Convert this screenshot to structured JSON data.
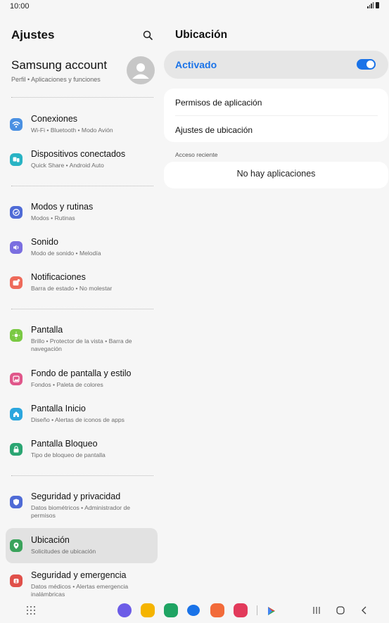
{
  "status_bar": {
    "time": "10:00"
  },
  "left_pane": {
    "title": "Ajustes",
    "account": {
      "title": "Samsung account",
      "subtitle": "Perfil  •  Aplicaciones y funciones"
    },
    "items": [
      {
        "label": "Conexiones",
        "subtitle": "Wi-Fi  •  Bluetooth  •  Modo Avión",
        "icon": "wifi-icon",
        "color": "#4a90e2"
      },
      {
        "label": "Dispositivos conectados",
        "subtitle": "Quick Share  •  Android Auto",
        "icon": "connected-devices-icon",
        "color": "#28b3c4"
      },
      {
        "label": "Modos y rutinas",
        "subtitle": "Modos  •  Rutinas",
        "icon": "modes-icon",
        "color": "#4f6bd6"
      },
      {
        "label": "Sonido",
        "subtitle": "Modo de sonido  •  Melodía",
        "icon": "sound-icon",
        "color": "#7a6ee0"
      },
      {
        "label": "Notificaciones",
        "subtitle": "Barra de estado  •  No molestar",
        "icon": "notifications-icon",
        "color": "#ee6a5a"
      },
      {
        "label": "Pantalla",
        "subtitle": "Brillo  •  Protector de la vista  •  Barra de navegación",
        "icon": "display-icon",
        "color": "#7ac943"
      },
      {
        "label": "Fondo de pantalla y estilo",
        "subtitle": "Fondos  •  Paleta de colores",
        "icon": "wallpaper-icon",
        "color": "#e0568a"
      },
      {
        "label": "Pantalla Inicio",
        "subtitle": "Diseño  •  Alertas de iconos de apps",
        "icon": "home-icon",
        "color": "#2ba6de"
      },
      {
        "label": "Pantalla Bloqueo",
        "subtitle": "Tipo de bloqueo de pantalla",
        "icon": "lock-icon",
        "color": "#2aa572"
      },
      {
        "label": "Seguridad y privacidad",
        "subtitle": "Datos biométricos  •  Administrador de permisos",
        "icon": "shield-icon",
        "color": "#4f6bd6"
      },
      {
        "label": "Ubicación",
        "subtitle": "Solicitudes de ubicación",
        "icon": "location-icon",
        "color": "#3aa35b"
      },
      {
        "label": "Seguridad y emergencia",
        "subtitle": "Datos médicos  •  Alertas emergencia inalámbricas",
        "icon": "emergency-icon",
        "color": "#e0504a"
      }
    ]
  },
  "right_pane": {
    "title": "Ubicación",
    "toggle": {
      "label": "Activado",
      "on": true
    },
    "options": [
      "Permisos de aplicación",
      "Ajustes de ubicación"
    ],
    "recent_label": "Acceso reciente",
    "recent_empty": "No hay aplicaciones"
  },
  "dock_apps": [
    {
      "name": "internet-app-icon",
      "color": "#6c5ce7"
    },
    {
      "name": "files-app-icon",
      "color": "#f5b400"
    },
    {
      "name": "phone-app-icon",
      "color": "#1fa463"
    },
    {
      "name": "messages-app-icon",
      "color": "#1a73e8"
    },
    {
      "name": "contacts-app-icon",
      "color": "#f26b3a"
    },
    {
      "name": "camera-app-icon",
      "color": "#e23a5b"
    },
    {
      "name": "play-store-app-icon",
      "color": "#34a853"
    }
  ],
  "colors": {
    "accent": "#1a73e8",
    "background": "#f6f6f6",
    "card": "#ffffff"
  }
}
